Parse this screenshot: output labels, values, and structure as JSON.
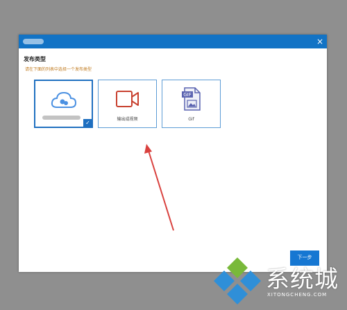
{
  "dialog": {
    "close_glyph": "×",
    "heading": "发布类型",
    "subheading": "请在下面的列表中选择一个发布类型"
  },
  "cards": [
    {
      "label": "",
      "icon": "cloud-icon",
      "selected": true
    },
    {
      "label": "输出成视频",
      "icon": "video-camera-icon",
      "selected": false
    },
    {
      "label": "Gif",
      "icon": "gif-file-icon",
      "selected": false
    }
  ],
  "next_button": {
    "label": "下一步"
  },
  "watermark": {
    "text": "系统城",
    "subtext": "XITONGCHENG.COM"
  },
  "colors": {
    "titlebar": "#1273c5",
    "selection": "#1e6fc0",
    "arrow": "#d9413e"
  }
}
